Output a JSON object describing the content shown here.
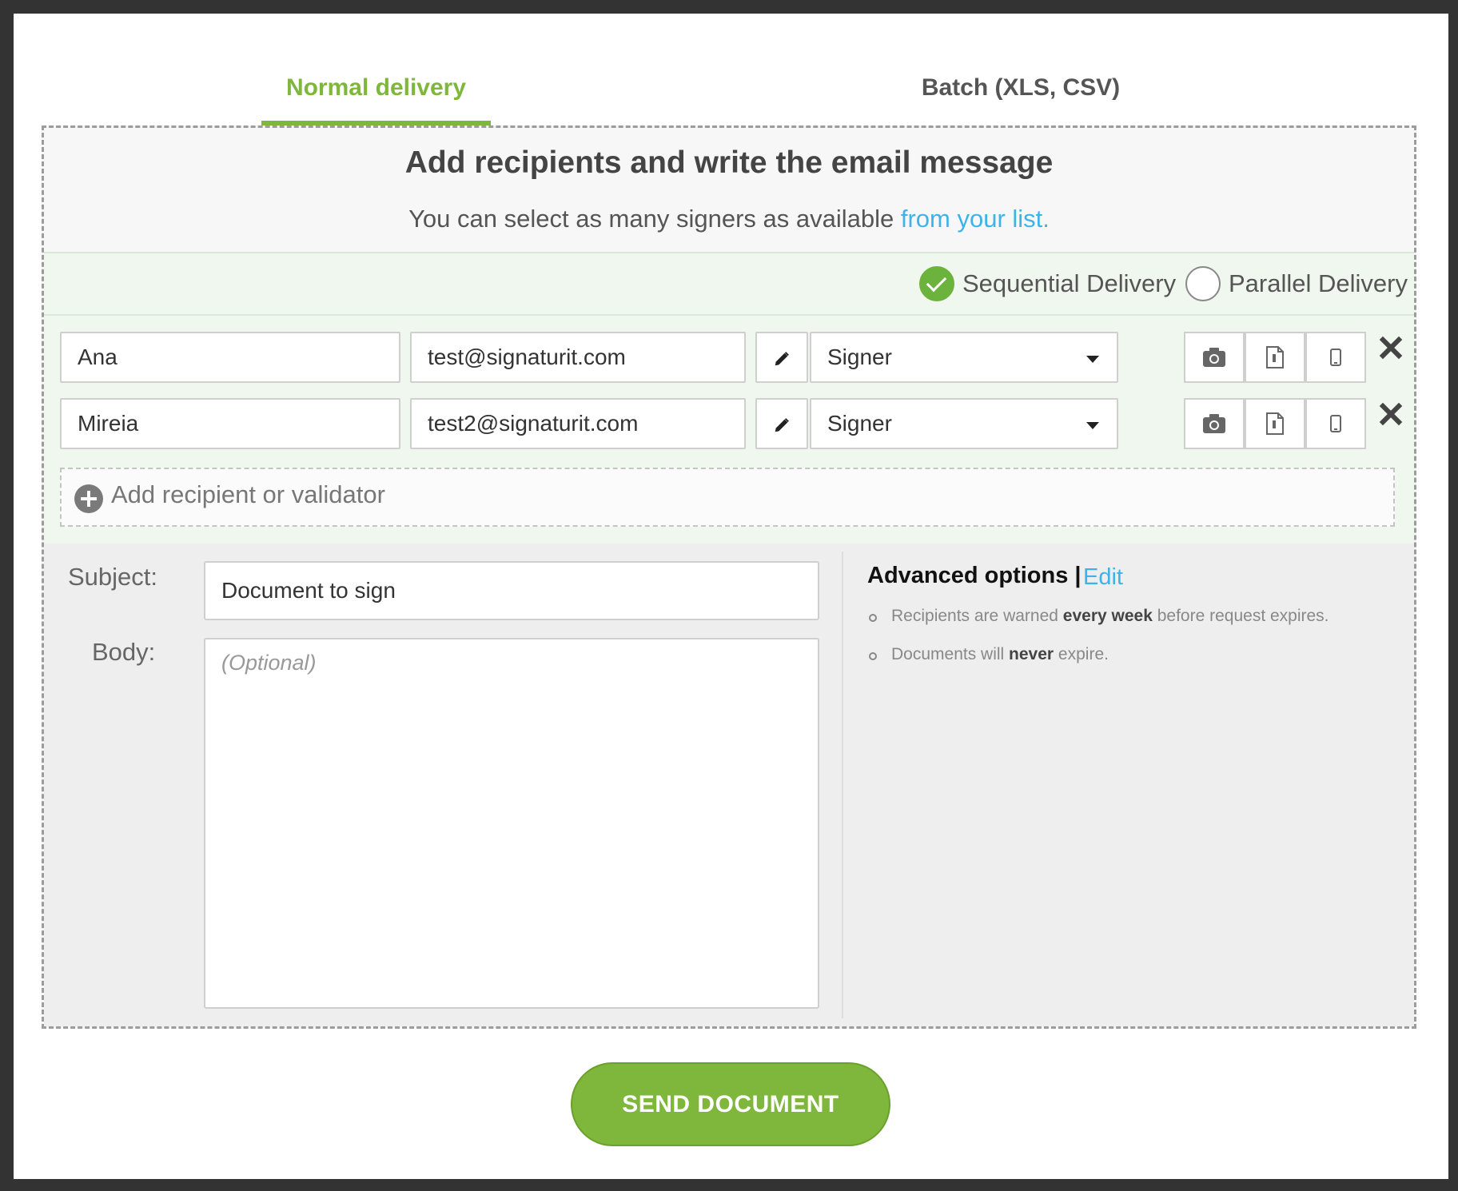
{
  "tabs": [
    {
      "label": "Normal delivery",
      "active": true
    },
    {
      "label": "Batch (XLS, CSV)",
      "active": false
    }
  ],
  "header": {
    "title": "Add recipients and write the email message",
    "subtitle_text": "You can select as many signers as available ",
    "subtitle_link": "from your list."
  },
  "delivery": {
    "sequential_label": "Sequential Delivery",
    "parallel_label": "Parallel Delivery",
    "selected": "sequential"
  },
  "recipients": [
    {
      "name": "Ana",
      "email": "test@signaturit.com",
      "role": "Signer"
    },
    {
      "name": "Mireia",
      "email": "test2@signaturit.com",
      "role": "Signer"
    }
  ],
  "add_recipient_label": "Add recipient or validator",
  "message": {
    "subject_label": "Subject:",
    "subject_value": "Document to sign",
    "body_label": "Body:",
    "body_placeholder": "(Optional)"
  },
  "advanced": {
    "title": "Advanced options |",
    "edit_label": "Edit",
    "item1_pre": "Recipients are warned ",
    "item1_bold": "every week",
    "item1_post": " before request expires.",
    "item2_pre": "Documents will ",
    "item2_bold": "never",
    "item2_post": " expire."
  },
  "send_button": "SEND DOCUMENT",
  "colors": {
    "accent": "#7fb73c",
    "link": "#3fb2e8"
  },
  "icons": [
    "pencil-icon",
    "camera-icon",
    "document-attach-icon",
    "mobile-icon",
    "close-icon",
    "plus-circle-icon",
    "check-icon"
  ]
}
